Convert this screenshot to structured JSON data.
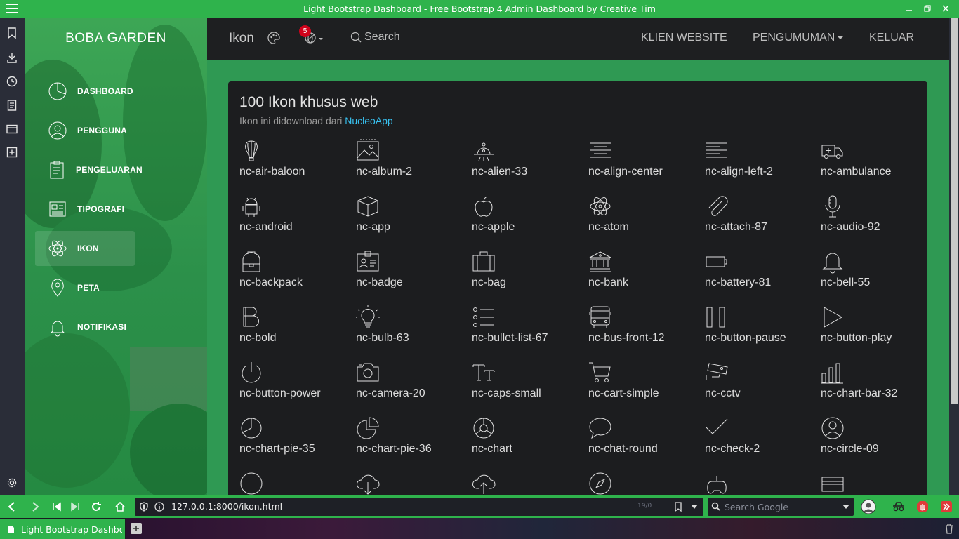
{
  "window": {
    "title": "Light Bootstrap Dashboard - Free Bootstrap 4 Admin Dashboard by Creative Tim"
  },
  "sidebar": {
    "brand": "BOBA GARDEN",
    "items": [
      {
        "label": "DASHBOARD",
        "icon": "chart-pie-icon",
        "active": false
      },
      {
        "label": "PENGGUNA",
        "icon": "user-circle-icon",
        "active": false
      },
      {
        "label": "PENGELUARAN",
        "icon": "clipboard-icon",
        "active": false
      },
      {
        "label": "TIPOGRAFI",
        "icon": "newspaper-icon",
        "active": false
      },
      {
        "label": "IKON",
        "icon": "atom-icon",
        "active": true
      },
      {
        "label": "PETA",
        "icon": "map-pin-icon",
        "active": false
      },
      {
        "label": "NOTIFIKASI",
        "icon": "bell-icon",
        "active": false
      }
    ]
  },
  "topbar": {
    "title": "Ikon",
    "notification_count": "5",
    "search_label": "Search",
    "links": {
      "client": "KLIEN WEBSITE",
      "announcement": "PENGUMUMAN",
      "logout": "KELUAR"
    }
  },
  "card": {
    "title": "100 Ikon khusus web",
    "subtitle": "Ikon ini didownload dari",
    "link_text": "NucleoApp",
    "icons": [
      "nc-air-baloon",
      "nc-album-2",
      "nc-alien-33",
      "nc-align-center",
      "nc-align-left-2",
      "nc-ambulance",
      "nc-android",
      "nc-app",
      "nc-apple",
      "nc-atom",
      "nc-attach-87",
      "nc-audio-92",
      "nc-backpack",
      "nc-badge",
      "nc-bag",
      "nc-bank",
      "nc-battery-81",
      "nc-bell-55",
      "nc-bold",
      "nc-bulb-63",
      "nc-bullet-list-67",
      "nc-bus-front-12",
      "nc-button-pause",
      "nc-button-play",
      "nc-button-power",
      "nc-camera-20",
      "nc-caps-small",
      "nc-cart-simple",
      "nc-cctv",
      "nc-chart-bar-32",
      "nc-chart-pie-35",
      "nc-chart-pie-36",
      "nc-chart",
      "nc-chat-round",
      "nc-check-2",
      "nc-circle-09"
    ]
  },
  "browser": {
    "url": "127.0.0.1:8000/ikon.html",
    "find_count": "19/0",
    "search_placeholder": "Search Google",
    "tab_title": "Light Bootstrap Dashboard"
  },
  "colors": {
    "accent_green": "#2fb34c",
    "content_green": "#2f9953",
    "card_bg": "#1c1d1f",
    "link_blue": "#38c1f0",
    "badge_red": "#d0021b"
  }
}
